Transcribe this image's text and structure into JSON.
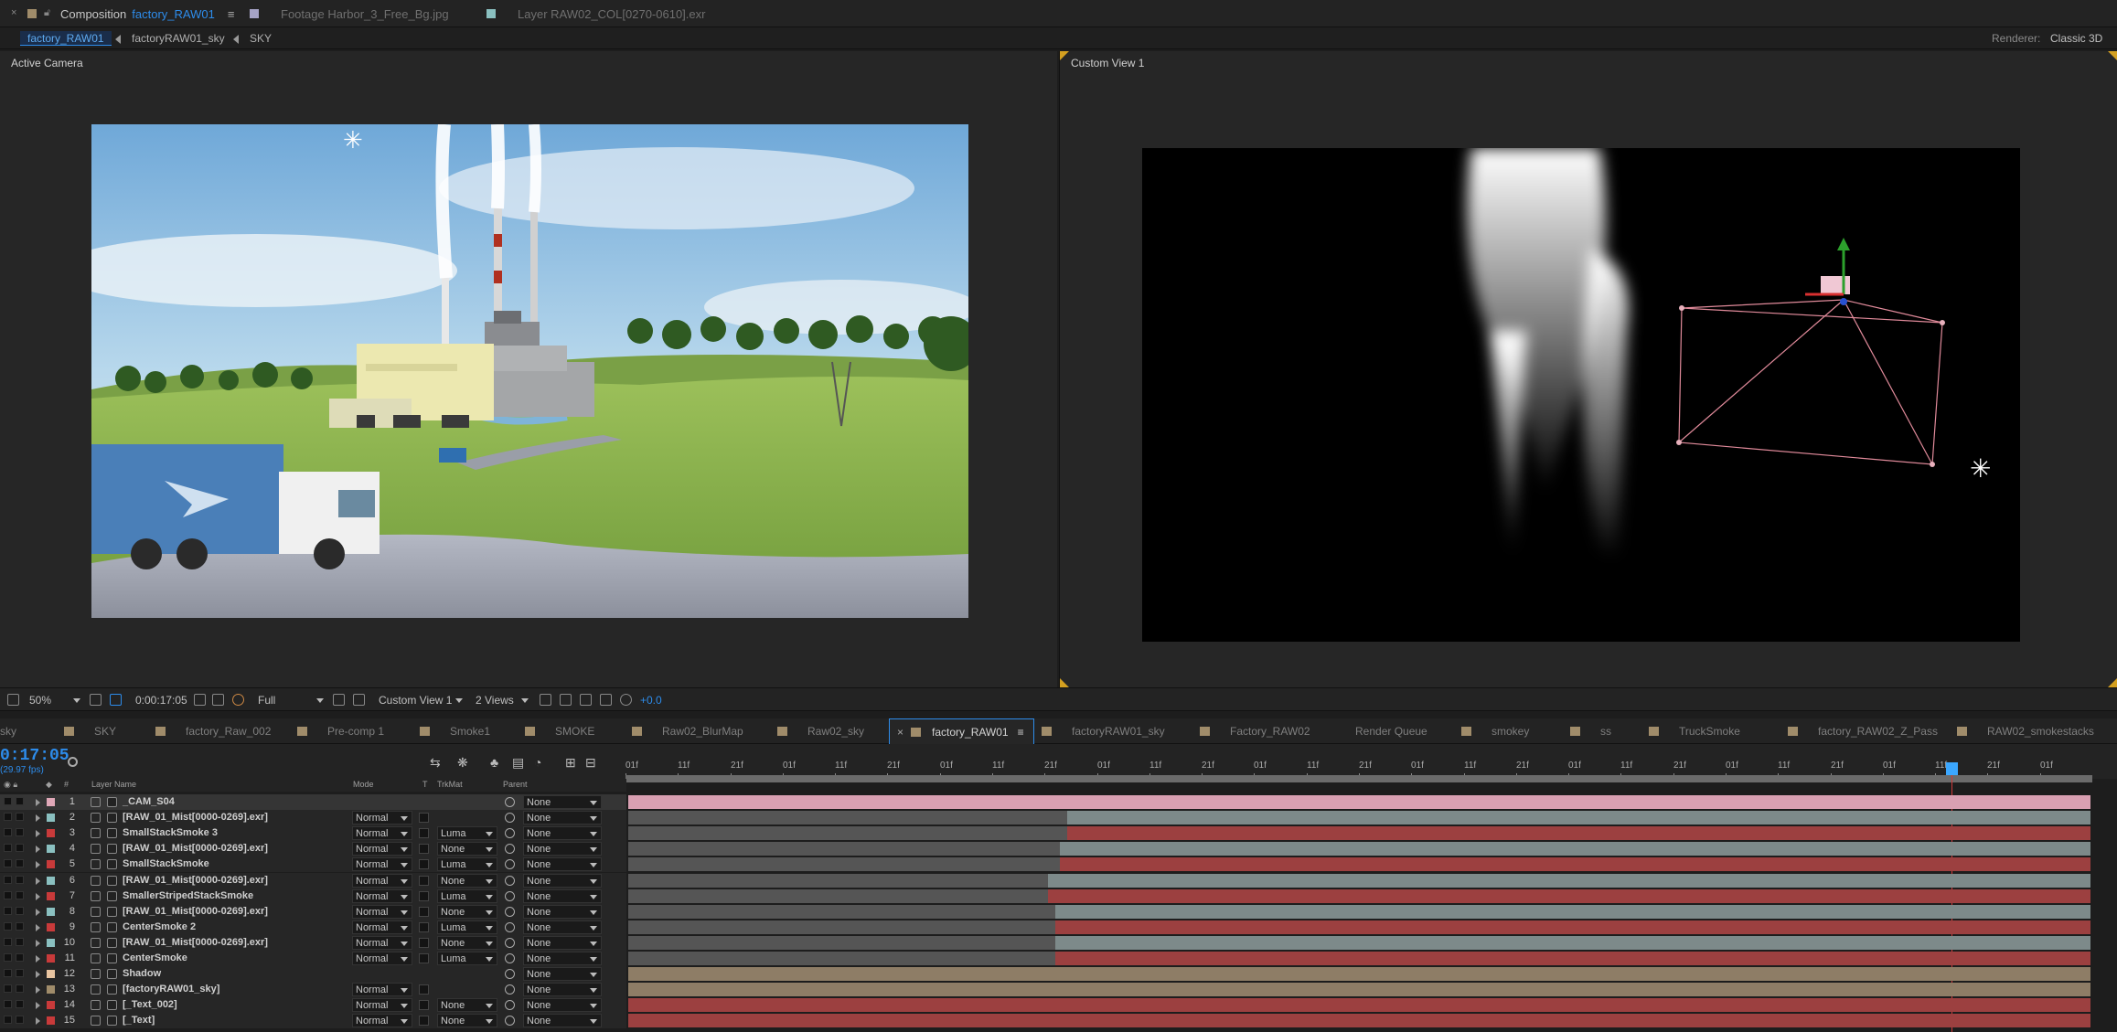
{
  "top_tabs": [
    {
      "prefix": "Composition",
      "label": "factory_RAW01",
      "color": "#a08c6a"
    },
    {
      "label": "Footage Harbor_3_Free_Bg.jpg",
      "color": "#a6a3c6"
    },
    {
      "label": "Layer RAW02_COL[0270-0610].exr",
      "color": "#8ac0c0"
    }
  ],
  "breadcrumbs": [
    "factory_RAW01",
    "factoryRAW01_sky",
    "SKY"
  ],
  "renderer": {
    "label": "Renderer:",
    "value": "Classic 3D"
  },
  "viewers": {
    "left_label": "Active Camera",
    "right_label": "Custom View 1"
  },
  "viewer_toolbar": {
    "zoom": "50%",
    "timecode": "0:00:17:05",
    "resolution": "Full",
    "view": "Custom View 1",
    "views": "2 Views",
    "exposure": "+0.0"
  },
  "timeline_tabs": [
    {
      "label": "sky",
      "color": ""
    },
    {
      "label": "SKY",
      "color": "#a08c6a"
    },
    {
      "label": "factory_Raw_002",
      "color": "#a08c6a"
    },
    {
      "label": "Pre-comp 1",
      "color": "#a08c6a"
    },
    {
      "label": "Smoke1",
      "color": "#a08c6a"
    },
    {
      "label": "SMOKE",
      "color": "#a08c6a"
    },
    {
      "label": "Raw02_BlurMap",
      "color": "#a08c6a"
    },
    {
      "label": "Raw02_sky",
      "color": "#a08c6a"
    },
    {
      "label": "factory_RAW01",
      "color": "#a08c6a",
      "active": true
    },
    {
      "label": "factoryRAW01_sky",
      "color": "#a08c6a"
    },
    {
      "label": "Factory_RAW02",
      "color": "#a08c6a"
    },
    {
      "label": "Render Queue",
      "color": ""
    },
    {
      "label": "smokey",
      "color": "#a08c6a"
    },
    {
      "label": "ss",
      "color": "#a08c6a"
    },
    {
      "label": "TruckSmoke",
      "color": "#a08c6a"
    },
    {
      "label": "factory_RAW02_Z_Pass",
      "color": "#a08c6a"
    },
    {
      "label": "RAW02_smokestacks",
      "color": "#a08c6a"
    }
  ],
  "timeline": {
    "timecode": "0:17:05",
    "fps": "(29.97 fps)",
    "columns": {
      "num": "#",
      "name": "Layer Name",
      "mode": "Mode",
      "t": "T",
      "trkmat": "TrkMat",
      "parent": "Parent"
    },
    "ruler_labels": [
      "01f",
      "11f",
      "21f",
      "01f",
      "11f",
      "21f",
      "01f",
      "11f",
      "21f",
      "01f",
      "11f",
      "21f",
      "01f",
      "11f",
      "21f",
      "01f",
      "11f",
      "21f",
      "01f",
      "11f",
      "21f",
      "01f",
      "11f",
      "21f",
      "01f",
      "11f",
      "21f",
      "01f"
    ],
    "layers": [
      {
        "num": "1",
        "name": "_CAM_S04",
        "mode": "",
        "trkmat": "",
        "parent": "None",
        "label_color": "#e0a8b8",
        "bar_color": "#d9a0b2",
        "split": null
      },
      {
        "num": "2",
        "name": "[RAW_01_Mist[0000-0269].exr]",
        "mode": "Normal",
        "trkmat": "",
        "parent": "None",
        "label_color": "#8ac0c0",
        "bar_color": "#7d8a8a",
        "split": 30
      },
      {
        "num": "3",
        "name": "SmallStackSmoke 3",
        "mode": "Normal",
        "trkmat": "Luma",
        "parent": "None",
        "label_color": "#c83a3a",
        "bar_color": "#9c4040",
        "split": 30
      },
      {
        "num": "4",
        "name": "[RAW_01_Mist[0000-0269].exr]",
        "mode": "Normal",
        "trkmat": "None",
        "parent": "None",
        "label_color": "#8ac0c0",
        "bar_color": "#7d8a8a",
        "split": 29.5
      },
      {
        "num": "5",
        "name": "SmallStackSmoke",
        "mode": "Normal",
        "trkmat": "Luma",
        "parent": "None",
        "label_color": "#c83a3a",
        "bar_color": "#9c4040",
        "split": 29.5
      },
      {
        "num": "6",
        "name": "[RAW_01_Mist[0000-0269].exr]",
        "mode": "Normal",
        "trkmat": "None",
        "parent": "None",
        "label_color": "#8ac0c0",
        "bar_color": "#7d8a8a",
        "split": 28.7
      },
      {
        "num": "7",
        "name": "SmallerStripedStackSmoke",
        "mode": "Normal",
        "trkmat": "Luma",
        "parent": "None",
        "label_color": "#c83a3a",
        "bar_color": "#9c4040",
        "split": 28.7
      },
      {
        "num": "8",
        "name": "[RAW_01_Mist[0000-0269].exr]",
        "mode": "Normal",
        "trkmat": "None",
        "parent": "None",
        "label_color": "#8ac0c0",
        "bar_color": "#7d8a8a",
        "split": 29.2
      },
      {
        "num": "9",
        "name": "CenterSmoke 2",
        "mode": "Normal",
        "trkmat": "Luma",
        "parent": "None",
        "label_color": "#c83a3a",
        "bar_color": "#9c4040",
        "split": 29.2
      },
      {
        "num": "10",
        "name": "[RAW_01_Mist[0000-0269].exr]",
        "mode": "Normal",
        "trkmat": "None",
        "parent": "None",
        "label_color": "#8ac0c0",
        "bar_color": "#7d8a8a",
        "split": 29.2
      },
      {
        "num": "11",
        "name": "CenterSmoke",
        "mode": "Normal",
        "trkmat": "Luma",
        "parent": "None",
        "label_color": "#c83a3a",
        "bar_color": "#9c4040",
        "split": 29.2
      },
      {
        "num": "12",
        "name": "Shadow",
        "mode": "",
        "trkmat": "",
        "parent": "None",
        "label_color": "#e8c4a0",
        "bar_color": "#8e7d66",
        "split": null
      },
      {
        "num": "13",
        "name": "[factoryRAW01_sky]",
        "mode": "Normal",
        "trkmat": "",
        "parent": "None",
        "label_color": "#a08c6a",
        "bar_color": "#8e7d66",
        "split": null
      },
      {
        "num": "14",
        "name": "[_Text_002]",
        "mode": "Normal",
        "trkmat": "None",
        "parent": "None",
        "label_color": "#c83a3a",
        "bar_color": "#9c4040",
        "split": null
      },
      {
        "num": "15",
        "name": "[_Text]",
        "mode": "Normal",
        "trkmat": "None",
        "parent": "None",
        "label_color": "#c83a3a",
        "bar_color": "#9c4040",
        "split": null
      }
    ]
  }
}
